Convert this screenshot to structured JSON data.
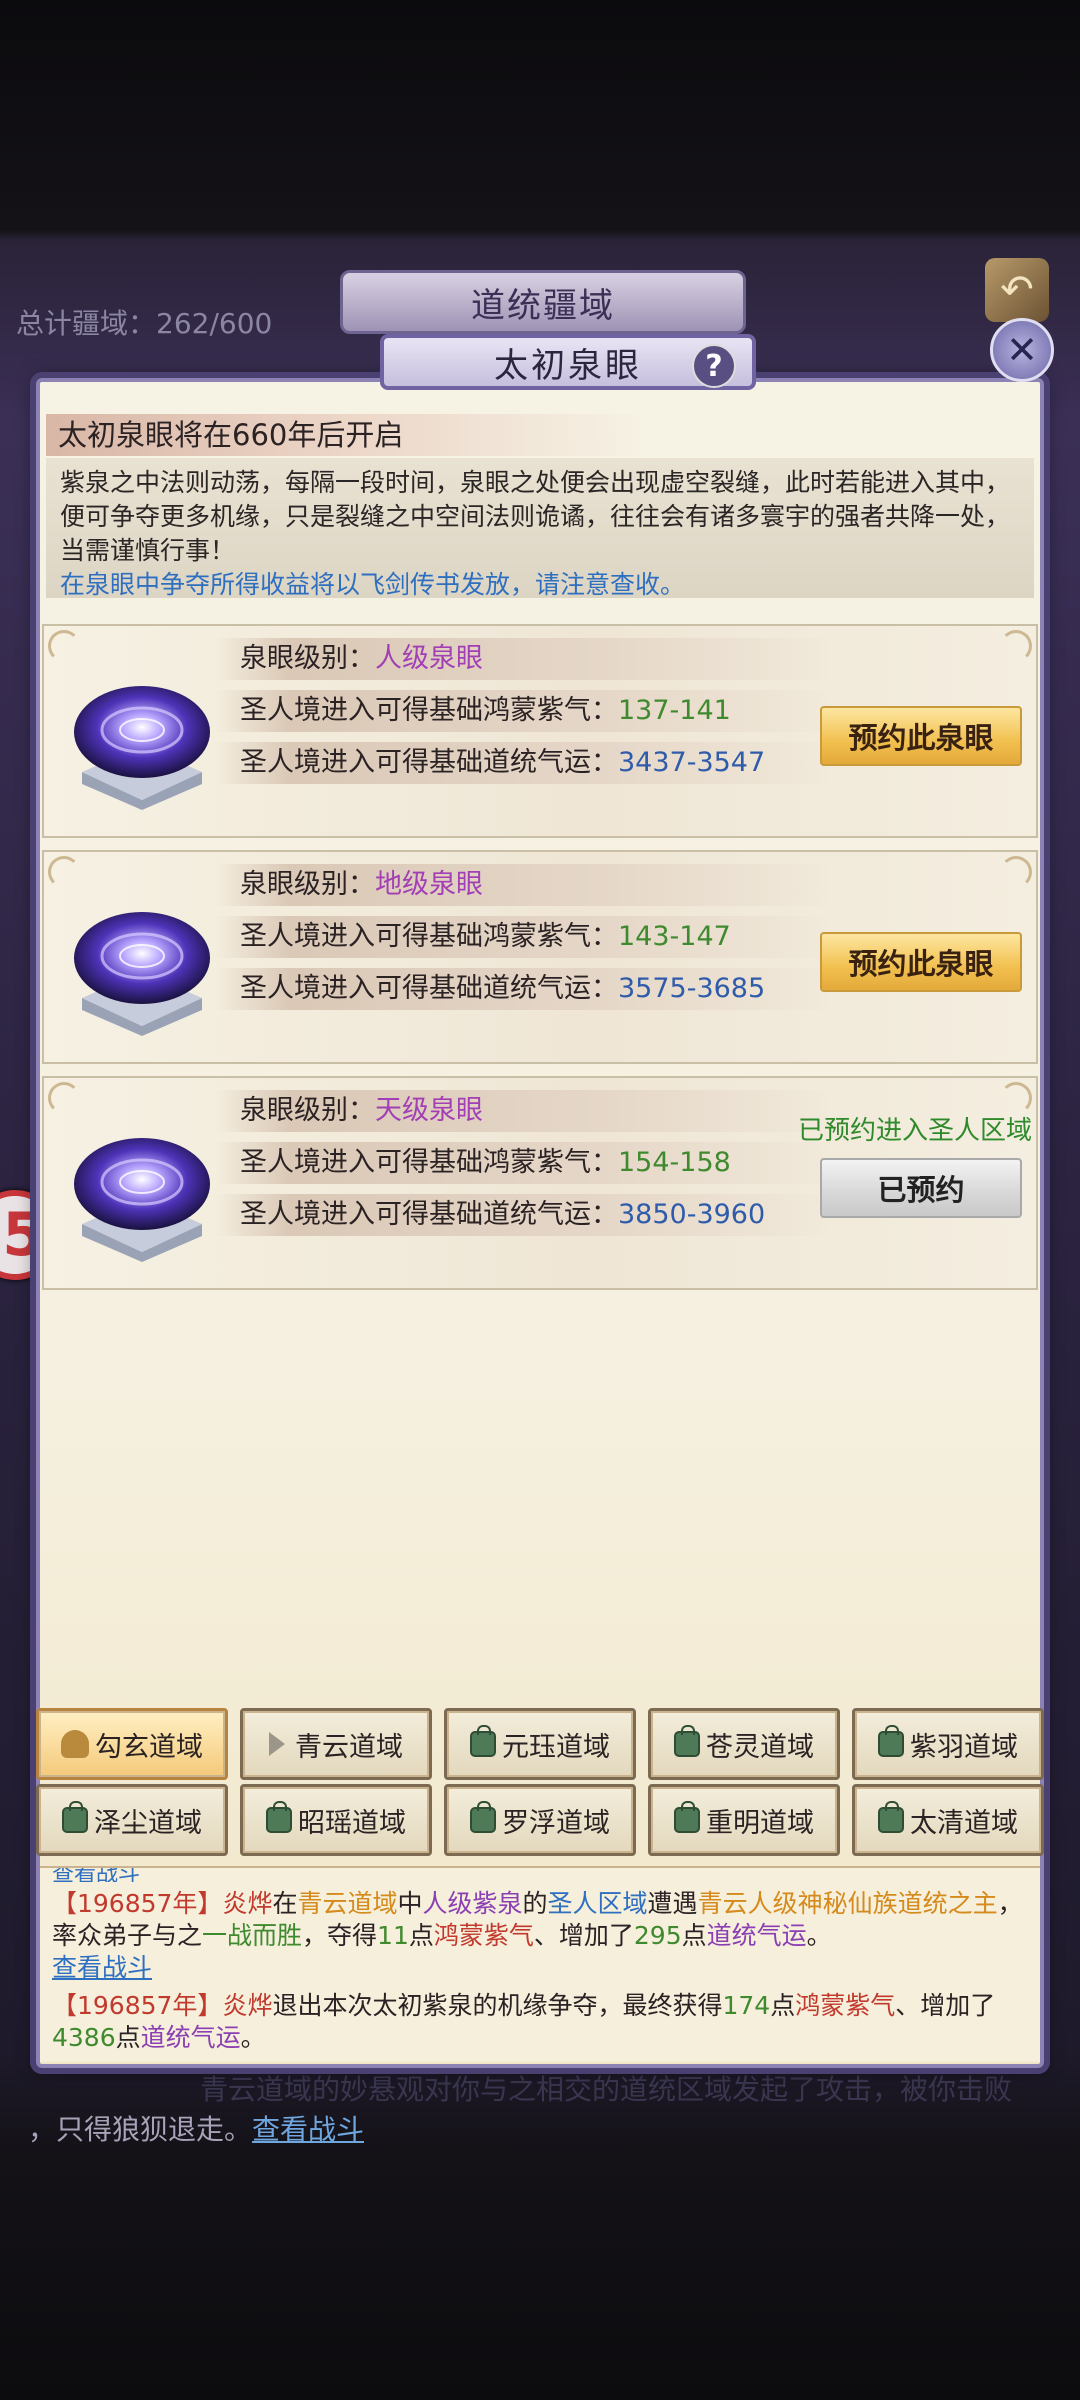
{
  "background": {
    "banner_title": "道统疆域",
    "total_territory": "总计疆域：262/600",
    "badge_text": "5",
    "text_behind_1": "青云道域的妙悬观对你与之相交的道统区域发起了攻击，被你击败",
    "text_behind_2": "，只得狼狈退走。",
    "text_behind_link": "查看战斗"
  },
  "dialog": {
    "title": "太初泉眼",
    "help_glyph": "?",
    "close_glyph": "✕",
    "open_notice": "太初泉眼将在660年后开启",
    "description": "紫泉之中法则动荡，每隔一段时间，泉眼之处便会出现虚空裂缝，此时若能进入其中，便可争夺更多机缘，只是裂缝之中空间法则诡谲，往往会有诸多寰宇的强者共降一处，当需谨慎行事！",
    "notice_blue": "在泉眼中争夺所得收益将以飞剑传书发放，请注意查收。"
  },
  "springs": [
    {
      "level_label": "泉眼级别：",
      "level_value": "人级泉眼",
      "qi_label": "圣人境进入可得基础鸿蒙紫气：",
      "qi_value": "137-141",
      "luck_label": "圣人境进入可得基础道统气运：",
      "luck_value": "3437-3547",
      "button": "预约此泉眼",
      "reserved": false
    },
    {
      "level_label": "泉眼级别：",
      "level_value": "地级泉眼",
      "qi_label": "圣人境进入可得基础鸿蒙紫气：",
      "qi_value": "143-147",
      "luck_label": "圣人境进入可得基础道统气运：",
      "luck_value": "3575-3685",
      "button": "预约此泉眼",
      "reserved": false
    },
    {
      "level_label": "泉眼级别：",
      "level_value": "天级泉眼",
      "qi_label": "圣人境进入可得基础鸿蒙紫气：",
      "qi_value": "154-158",
      "luck_label": "圣人境进入可得基础道统气运：",
      "luck_value": "3850-3960",
      "button": "已预约",
      "reserved": true,
      "reserved_note": "已预约进入圣人区域"
    }
  ],
  "tabs": [
    {
      "label": "勾玄道域",
      "icon": "person-icon",
      "active": true
    },
    {
      "label": "青云道域",
      "icon": "arrow-icon",
      "active": false
    },
    {
      "label": "元珏道域",
      "icon": "lock-icon",
      "active": false
    },
    {
      "label": "苍灵道域",
      "icon": "lock-icon",
      "active": false
    },
    {
      "label": "紫羽道域",
      "icon": "lock-icon",
      "active": false
    },
    {
      "label": "泽尘道域",
      "icon": "lock-icon",
      "active": false
    },
    {
      "label": "昭瑶道域",
      "icon": "lock-icon",
      "active": false
    },
    {
      "label": "罗浮道域",
      "icon": "lock-icon",
      "active": false
    },
    {
      "label": "重明道域",
      "icon": "lock-icon",
      "active": false
    },
    {
      "label": "太清道域",
      "icon": "lock-icon",
      "active": false
    }
  ],
  "log": {
    "cut_link": "查看战斗",
    "entry1": {
      "year": "【196857年】",
      "name": "炎烨",
      "t1": "在",
      "domain": "青云道域",
      "t2": "中",
      "spring": "人级紫泉",
      "t3": "的",
      "zone": "圣人区域",
      "t4": "遭遇",
      "enemy": "青云人级神秘仙族道统之主",
      "t5": "，率众弟子与之",
      "result": "一战而胜",
      "t6": "，夺得",
      "qi_amount": "11",
      "t7": "点",
      "qi_name": "鸿蒙紫气",
      "t8": "、增加了",
      "luck_amount": "295",
      "t9": "点",
      "luck_name": "道统气运",
      "t10": "。",
      "link": "查看战斗"
    },
    "entry2": {
      "year": "【196857年】",
      "name": "炎烨",
      "t1": "退出本次太初紫泉的机缘争夺，最终获得",
      "qi_amount": "174",
      "t2": "点",
      "qi_name": "鸿蒙紫气",
      "t3": "、增加了",
      "luck_amount": "4386",
      "t4": "点",
      "luck_name": "道统气运",
      "t5": "。"
    }
  },
  "colors": {
    "level_purple": "#a23fb5",
    "qi_green": "#3f8a2e",
    "luck_blue": "#2f5bab",
    "reserve_gold": "#f2c04f"
  }
}
